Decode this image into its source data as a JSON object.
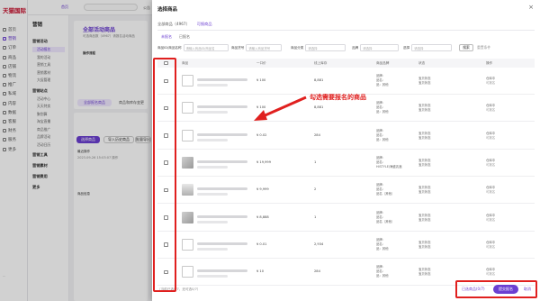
{
  "app": {
    "logo": "天猫国际",
    "topbar_tag": "首页",
    "topbar_links": [
      "公告",
      "规则",
      "学习",
      "服务"
    ]
  },
  "leftnav": [
    {
      "label": "首页"
    },
    {
      "label": "营销"
    },
    {
      "label": "订单"
    },
    {
      "label": "商品"
    },
    {
      "label": "店铺"
    },
    {
      "label": "物流"
    },
    {
      "label": "推广"
    },
    {
      "label": "私域"
    },
    {
      "label": "内容"
    },
    {
      "label": "数据"
    },
    {
      "label": "客服"
    },
    {
      "label": "财务"
    },
    {
      "label": "服务"
    },
    {
      "label": "更多"
    }
  ],
  "col2": {
    "header": "营销",
    "groups": [
      {
        "label": "营销活动",
        "links": [
          "活动报名",
          "我的活动",
          "营销工具",
          "营销素材",
          "大促管理"
        ]
      },
      {
        "label": "营销站点",
        "links": [
          "活动中心",
          "天天特卖",
          "聚划算",
          "淘宝直播",
          "商品推广",
          "品牌活动",
          "活动日历"
        ]
      },
      {
        "label": "营销工具",
        "links": []
      },
      {
        "label": "营销素材",
        "links": []
      },
      {
        "label": "营销费用",
        "links": []
      },
      {
        "label": "更多",
        "links": []
      }
    ]
  },
  "bg": {
    "title": "全部活动商品",
    "subtitle": "可选商品数（4967）请报名活动商品",
    "section": "操作流程",
    "tabs": [
      "全部报名商品",
      "商品和库存变更"
    ],
    "btn_primary": "选择商品",
    "btn_secondary": "导入历史商品",
    "btn_third": "批量导出",
    "info": "最近操作",
    "date": "2023-09-26 15:03:07 操作",
    "list_header": "商品信息"
  },
  "modal": {
    "title": "选择商品",
    "close": "×",
    "tabs": [
      "全部商品（4967）",
      "可报商品"
    ],
    "active_tab": 1,
    "subtabs": [
      "未报名",
      "已报名"
    ],
    "filters": [
      {
        "label": "商品ID/商品名称",
        "placeholder": "请输入商品ID/商品名"
      },
      {
        "label": "商品货号",
        "placeholder": "请输入商品货号"
      },
      {
        "label": "商品分类",
        "placeholder": "请选择"
      },
      {
        "label": "品牌",
        "placeholder": "请选择"
      },
      {
        "label": "选择",
        "placeholder": "请选择"
      }
    ],
    "search_btn": "搜索",
    "reset_btn": "重置条件",
    "columns": [
      "商品",
      "一口价",
      "线上库存",
      "商品品牌",
      "状态",
      "操作"
    ],
    "rows": [
      {
        "price": "¥ 100",
        "stock": "8,881",
        "brand": [
          "品牌：",
          "品名：",
          "品：其他"
        ],
        "status": [
          "宝贝状态",
          "宝贝状态"
        ],
        "op": [
          "仓库中",
          "可报名"
        ],
        "thumb": "sketch"
      },
      {
        "price": "¥ 100",
        "stock": "8,881",
        "brand": [
          "品牌：",
          "品名：",
          "品：其他"
        ],
        "status": [
          "宝贝状态",
          "宝贝状态"
        ],
        "op": [
          "仓库中",
          "可报名"
        ],
        "thumb": "sketch"
      },
      {
        "price": "¥ 0.02",
        "stock": "284",
        "brand": [
          "品牌：",
          "品名：",
          "品：其他"
        ],
        "status": [
          "宝贝状态",
          "宝贝状态"
        ],
        "op": [
          "仓库中",
          "可报名"
        ],
        "thumb": "sketch"
      },
      {
        "price": "¥ 19,999",
        "stock": "1",
        "brand": [
          "品牌：",
          "品名：",
          "HISTYLE/海盛兆鑫"
        ],
        "status": [
          "宝贝状态",
          "宝贝状态"
        ],
        "op": [
          "仓库中",
          "可报名"
        ],
        "thumb": "photo"
      },
      {
        "price": "¥ 9,999",
        "stock": "2",
        "brand": [
          "品牌：",
          "品名：",
          "品名（其他）"
        ],
        "status": [
          "宝贝状态",
          "宝贝状态"
        ],
        "op": [
          "仓库中",
          "可报名"
        ],
        "thumb": "photo2"
      },
      {
        "price": "¥ 8,888",
        "stock": "1",
        "brand": [
          "品牌：",
          "品名：",
          "品名（其他）"
        ],
        "status": [
          "宝贝状态",
          "宝贝状态"
        ],
        "op": [
          "仓库中",
          "可报名"
        ],
        "thumb": "photo"
      },
      {
        "price": "¥ 0.01",
        "stock": "2,934",
        "brand": [
          "品牌：",
          "品名：",
          "品：其他"
        ],
        "status": [
          "宝贝状态",
          "宝贝状态"
        ],
        "op": [
          "仓库中",
          "可报名"
        ],
        "thumb": "sketch"
      },
      {
        "price": "¥ 10",
        "stock": "284",
        "brand": [
          "品牌：",
          "品名：",
          "品：其他"
        ],
        "status": [
          "宝贝状态",
          "宝贝状态"
        ],
        "op": [
          "仓库中",
          "可报名"
        ],
        "thumb": "sketch"
      }
    ],
    "footer_text": "（当前已选0/7，还可选0/7）",
    "selected_btn": "已选商品(0/7)",
    "submit_btn": "提交报名",
    "cancel_btn": "取消"
  },
  "annotation": {
    "text": "勾选需要报名的商品",
    "color": "#e0201f"
  },
  "colors": {
    "accent": "#6b3fd1",
    "annotation": "#e0201f"
  }
}
